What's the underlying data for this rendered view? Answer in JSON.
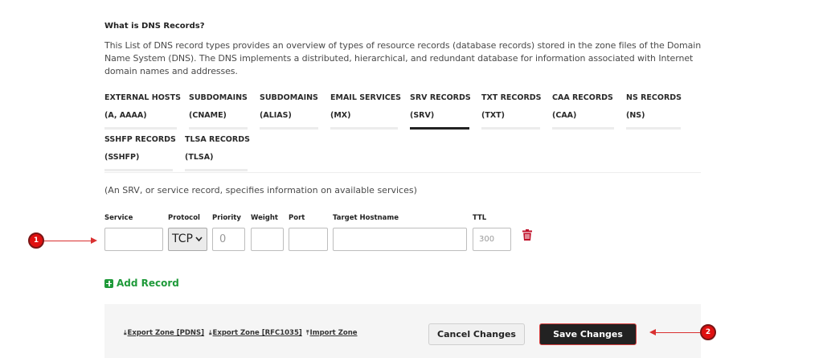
{
  "info": {
    "heading": "What is DNS Records?",
    "description": "This List of DNS record types provides an overview of types of resource records (database records) stored in the zone files of the Domain Name System (DNS). The DNS implements a distributed, hierarchical, and redundant database for information associated with Internet domain names and addresses."
  },
  "tabs": [
    {
      "label": "EXTERNAL HOSTS",
      "sub": "(A, AAAA)",
      "active": false
    },
    {
      "label": "SUBDOMAINS",
      "sub": "(CNAME)",
      "active": false
    },
    {
      "label": "SUBDOMAINS",
      "sub": "(ALIAS)",
      "active": false
    },
    {
      "label": "EMAIL SERVICES",
      "sub": "(MX)",
      "active": false
    },
    {
      "label": "SRV RECORDS",
      "sub": "(SRV)",
      "active": true
    },
    {
      "label": "TXT RECORDS",
      "sub": "(TXT)",
      "active": false
    },
    {
      "label": "CAA RECORDS",
      "sub": "(CAA)",
      "active": false
    },
    {
      "label": "NS RECORDS",
      "sub": "(NS)",
      "active": false
    },
    {
      "label": "SSHFP RECORDS",
      "sub": "(SSHFP)",
      "active": false
    },
    {
      "label": "TLSA RECORDS",
      "sub": "(TLSA)",
      "active": false
    }
  ],
  "srv": {
    "note": "(An SRV, or service record, specifies information on available services)",
    "columns": {
      "service": "Service",
      "protocol": "Protocol",
      "priority": "Priority",
      "weight": "Weight",
      "port": "Port",
      "target": "Target Hostname",
      "ttl": "TTL"
    },
    "row": {
      "service_value": "",
      "protocol_value": "TCP",
      "priority_placeholder": "0",
      "weight_value": "",
      "port_value": "",
      "target_value": "",
      "ttl_placeholder": "300"
    },
    "add_record_label": "Add Record"
  },
  "footer": {
    "export_pdns": "Export Zone [PDNS]",
    "export_rfc": "Export Zone [RFC1035]",
    "import": "Import Zone",
    "cancel_label": "Cancel Changes",
    "save_label": "Save Changes"
  },
  "annotations": {
    "marker_1": "1",
    "marker_2": "2",
    "color": "#e01010"
  },
  "colors": {
    "add_record": "#1f9a3a",
    "trash": "#c0102a",
    "active_tab": "#222222"
  }
}
